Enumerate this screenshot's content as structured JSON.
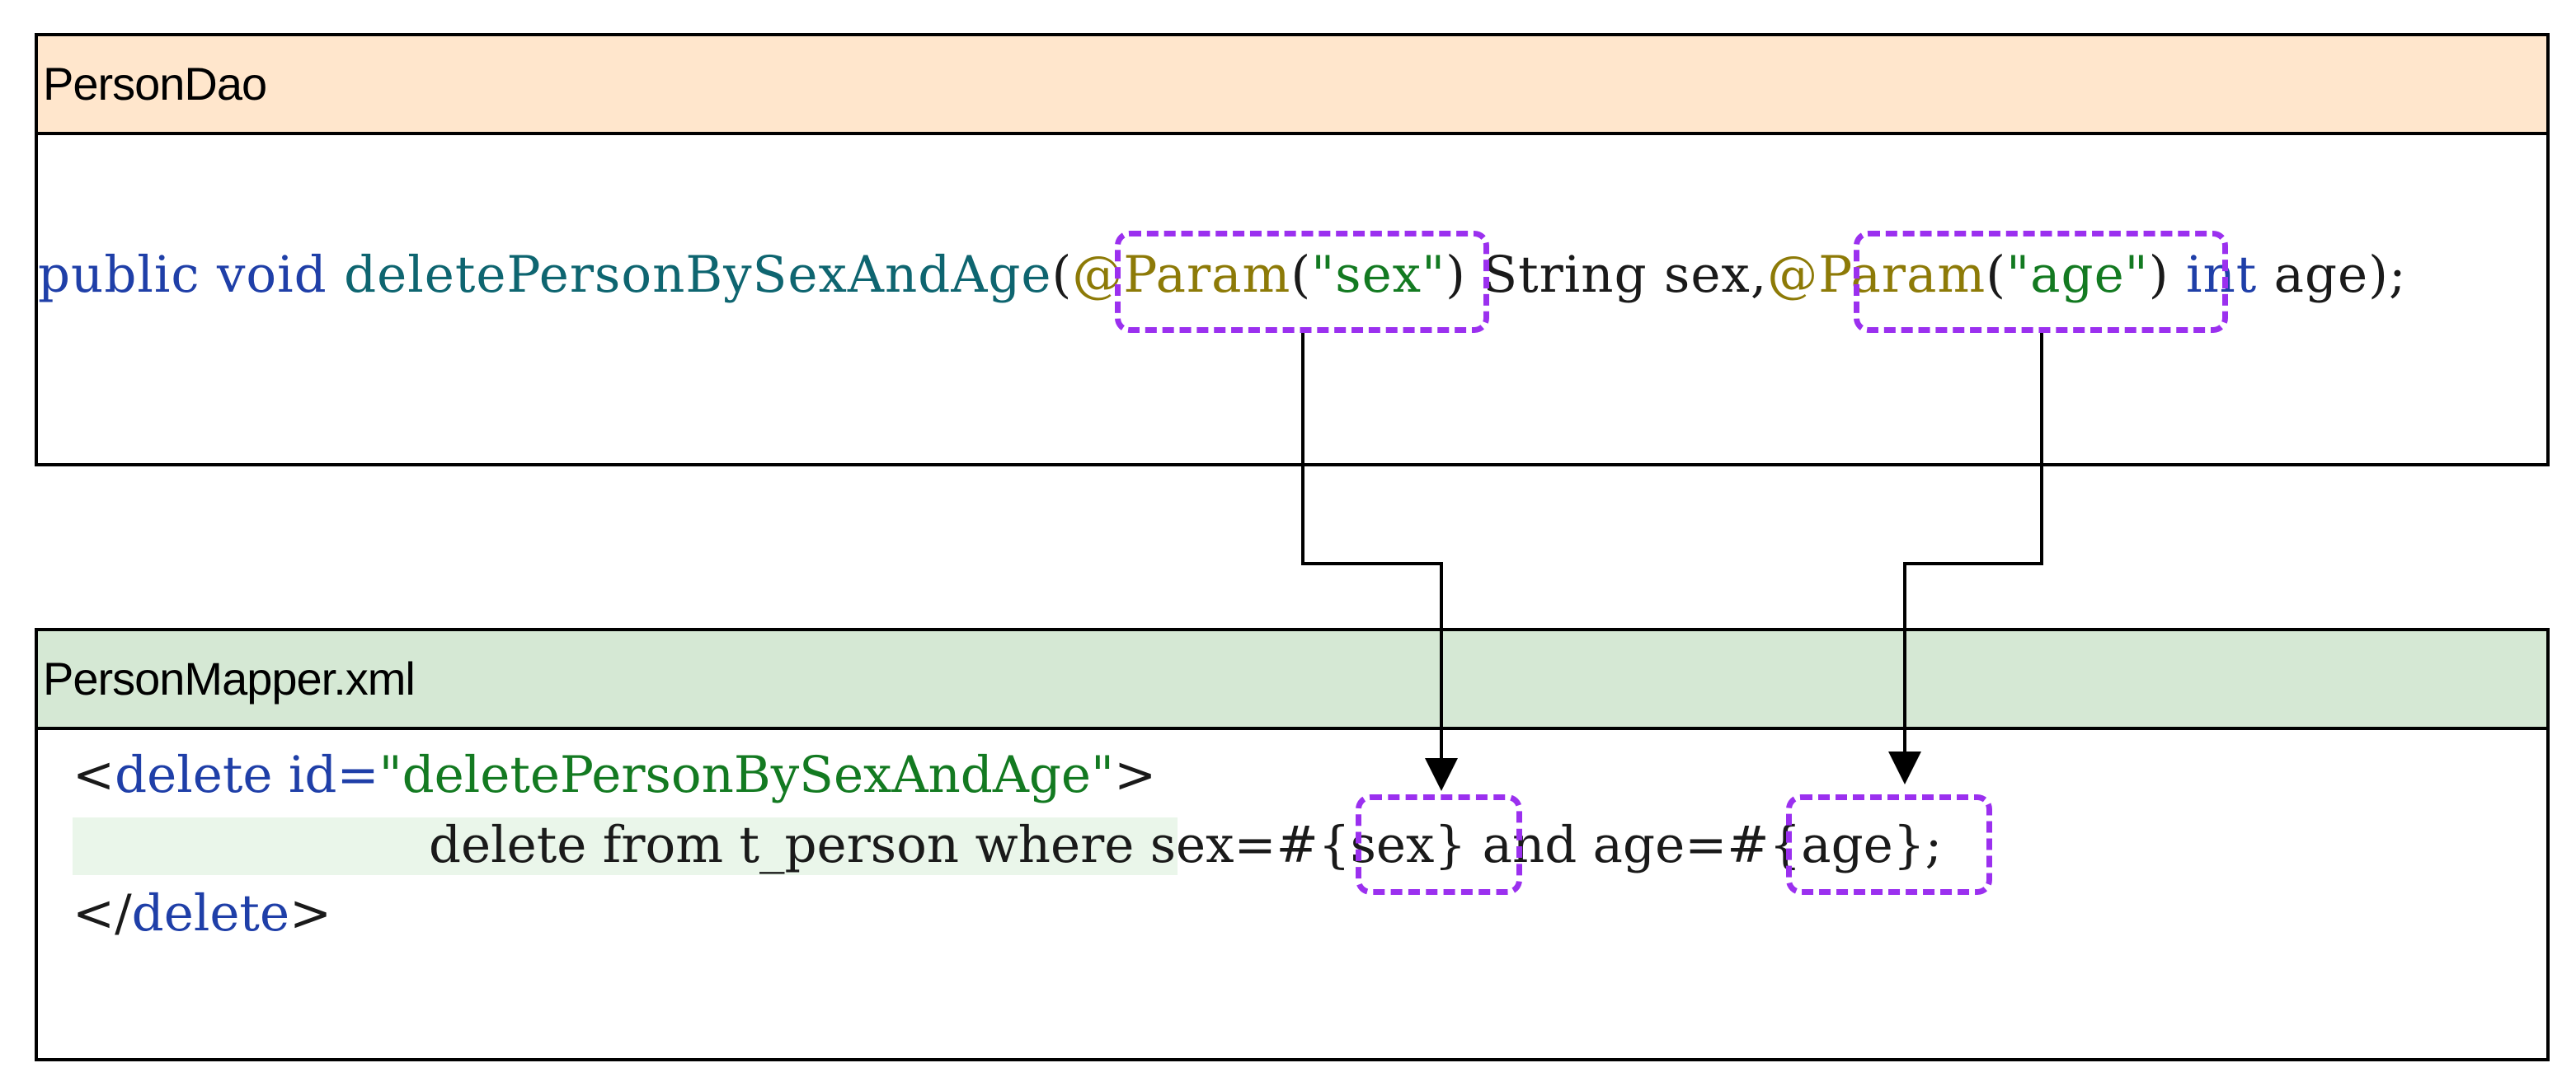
{
  "person_dao": {
    "title": "PersonDao",
    "method_signature": {
      "kw_public": "public",
      "kw_void": "void",
      "method_name": "deletePersonBySexAndAge",
      "paren_open": "(",
      "annotation_1": "@Param",
      "annotation_1_arg_open": "(",
      "annotation_1_value": "\"sex\"",
      "annotation_1_arg_close": ")",
      "param_1_decl": " String sex,",
      "annotation_2": "@Param",
      "annotation_2_arg_open": "(",
      "annotation_2_value": "\"age\"",
      "annotation_2_arg_close": ")",
      "kw_int": "int",
      "param_2_rest": " age);"
    }
  },
  "person_mapper": {
    "title": "PersonMapper.xml",
    "line_1": {
      "lt": "<",
      "tag_open": "delete id=",
      "id_value": "\"deletePersonBySexAndAge\"",
      "gt": ">"
    },
    "line_2": {
      "sql_prefix": "delete from t_person where sex=",
      "ref_sex": "#{sex}",
      "sql_middle": " and age=",
      "ref_age": "#{age}",
      "sql_end": ";"
    },
    "line_3": {
      "lt": "</",
      "tag_close": "delete",
      "gt": ">"
    }
  },
  "colors": {
    "dao_header": "#ffe6cc",
    "mapper_header": "#d5e8d4",
    "highlight_box": "#9b30ef",
    "keyword": "#1f3fa8",
    "annotation": "#8d7a07",
    "string": "#137a21"
  }
}
